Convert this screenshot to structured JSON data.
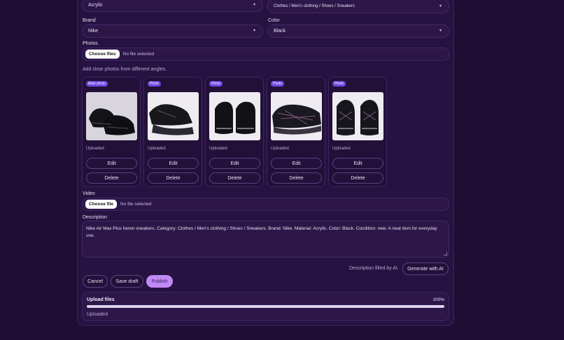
{
  "material": {
    "value": "Acrylic"
  },
  "category": {
    "value": "Clothes / Men's clothing / Shoes / Sneakers"
  },
  "brand": {
    "label": "Brand",
    "value": "Nike"
  },
  "color": {
    "label": "Color",
    "value": "Black"
  },
  "photos": {
    "label": "Photos",
    "button": "Choose files",
    "status": "No file selected",
    "hint": "Add clear photos from different angles.",
    "items": [
      {
        "badge": "Main photo",
        "status": "Uploaded",
        "edit": "Edit",
        "delete": "Delete"
      },
      {
        "badge": "Photo",
        "status": "Uploaded",
        "edit": "Edit",
        "delete": "Delete"
      },
      {
        "badge": "Photo",
        "status": "Uploaded",
        "edit": "Edit",
        "delete": "Delete"
      },
      {
        "badge": "Photo",
        "status": "Uploaded",
        "edit": "Edit",
        "delete": "Delete"
      },
      {
        "badge": "Photo",
        "status": "Uploaded",
        "edit": "Edit",
        "delete": "Delete"
      }
    ]
  },
  "video": {
    "label": "Video",
    "button": "Choose file",
    "status": "No file selected"
  },
  "description": {
    "label": "Description",
    "text": "Nike Air Max Plus heren sneakers. Category: Clothes / Men's clothing / Shoes / Sneakers. Brand: Nike. Material: Acrylic. Color: Black. Condition: new. A neat item for everyday use.",
    "ai_note": "Description filled by AI.",
    "ai_button": "Generate with AI"
  },
  "actions": {
    "cancel": "Cancel",
    "save_draft": "Save draft",
    "publish": "Publish"
  },
  "upload": {
    "title": "Upload files",
    "percent_label": "100%",
    "progress": 1.0,
    "status": "Uploaded"
  },
  "colors": {
    "accent": "#c08af5",
    "badge": "#6f48e0",
    "background": "#1f0d33"
  }
}
